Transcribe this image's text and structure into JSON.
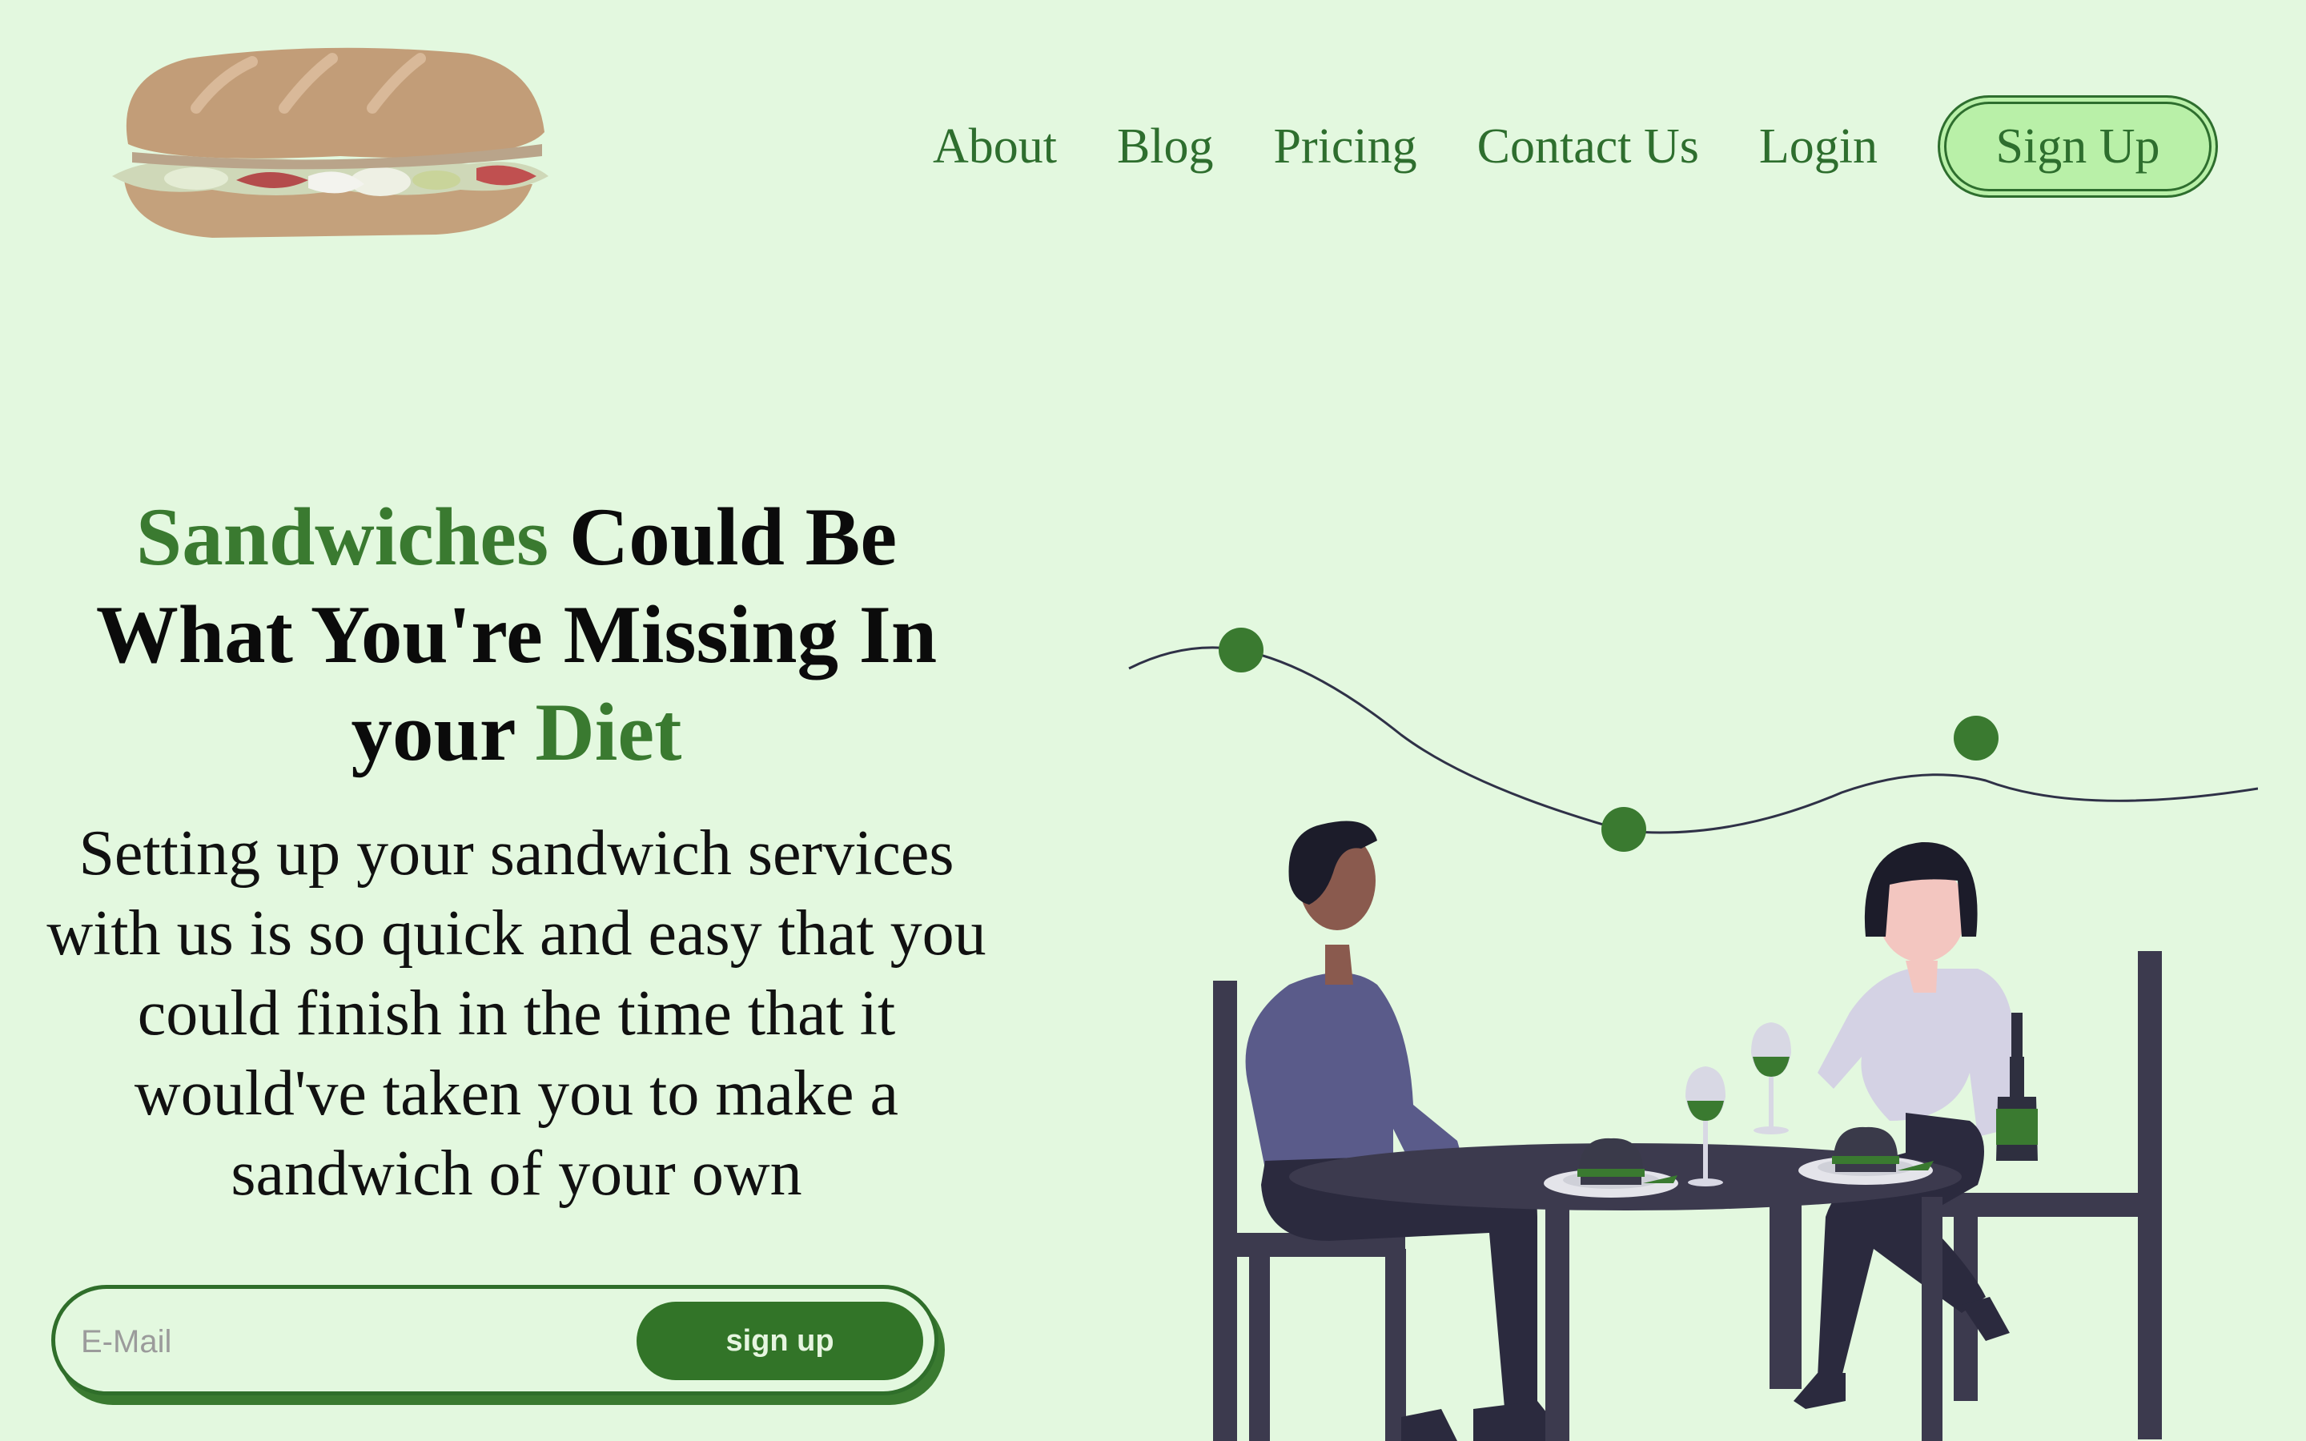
{
  "logo": {
    "icon": "sandwich-icon"
  },
  "nav": {
    "links": [
      {
        "label": "About"
      },
      {
        "label": "Blog"
      },
      {
        "label": "Pricing"
      },
      {
        "label": "Contact Us"
      },
      {
        "label": "Login"
      }
    ],
    "signup_label": "Sign Up"
  },
  "hero": {
    "title": {
      "part1_accent": "Sandwiches",
      "part2": " Could Be What You're Missing In your ",
      "part3_accent": "Diet"
    },
    "subtitle": "Setting up your sandwich services with us is so quick and easy that you could finish in the time that it would've taken you to make a sandwich of your own"
  },
  "form": {
    "email_placeholder": "E-Mail",
    "email_value": "",
    "button_label": "sign up"
  },
  "illustration": {
    "icon": "couple-dining-illustration"
  },
  "colors": {
    "background": "#e3f8df",
    "accent_green": "#3a7a30",
    "button_green": "#327428",
    "pill_fill": "#b9f0a8",
    "dark_text": "#0b0b0b"
  }
}
